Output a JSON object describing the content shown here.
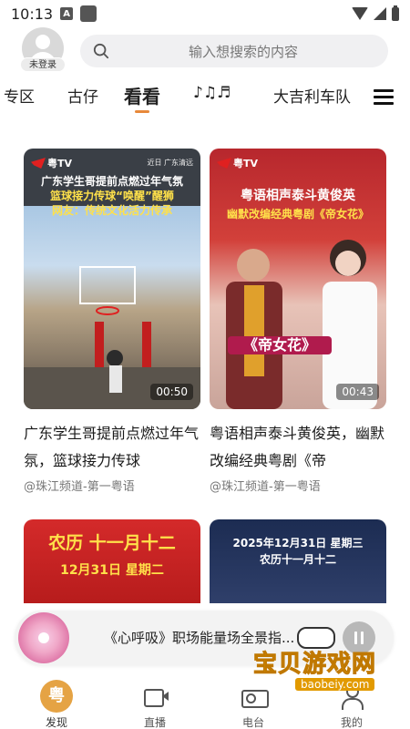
{
  "status_bar": {
    "time": "10:13"
  },
  "header": {
    "login_badge": "未登录",
    "search_placeholder": "输入想搜索的内容"
  },
  "tabs": {
    "items": [
      {
        "label": "专区"
      },
      {
        "label": "古仔"
      },
      {
        "label": "看看",
        "active": true
      },
      {
        "label": "♪♫♬"
      },
      {
        "label": "大吉利车队"
      }
    ]
  },
  "cards": [
    {
      "logo": "粤TV",
      "loc": "近日 广东清远",
      "headline_1": "广东学生哥提前点燃过年气氛",
      "headline_2": "篮球接力传球“唤醒”醒狮",
      "headline_3": "网友：传统文化活力传承",
      "duration": "00:50",
      "title": "广东学生哥提前点燃过年气氛，篮球接力传球",
      "source": "@珠江频道-第一粤语"
    },
    {
      "logo": "粤TV",
      "headline_1": "粤语相声泰斗黄俊英",
      "headline_2": "幽默改编经典粤剧《帝女花》",
      "overlay": "《帝女花》",
      "duration": "00:43",
      "title": "粤语相声泰斗黄俊英，幽默改编经典粤剧《帝",
      "source": "@珠江频道-第一粤语"
    },
    {
      "headline_1": "农历 十一月十二",
      "headline_2": "12月31日 星期二"
    },
    {
      "headline_1": "2025年12月31日 星期三",
      "headline_2": "农历十一月十二"
    }
  ],
  "player": {
    "title": "《心呼吸》职场能量场全景指..."
  },
  "bottom_nav": {
    "items": [
      {
        "label": "发现",
        "glyph": "粤",
        "active": true
      },
      {
        "label": "直播"
      },
      {
        "label": "电台"
      },
      {
        "label": "我的"
      }
    ]
  },
  "watermark": {
    "text": "宝贝游戏网",
    "url": "baobeiy.com"
  },
  "colors": {
    "accent": "#e8893a",
    "nav_active": "#e5a344"
  }
}
